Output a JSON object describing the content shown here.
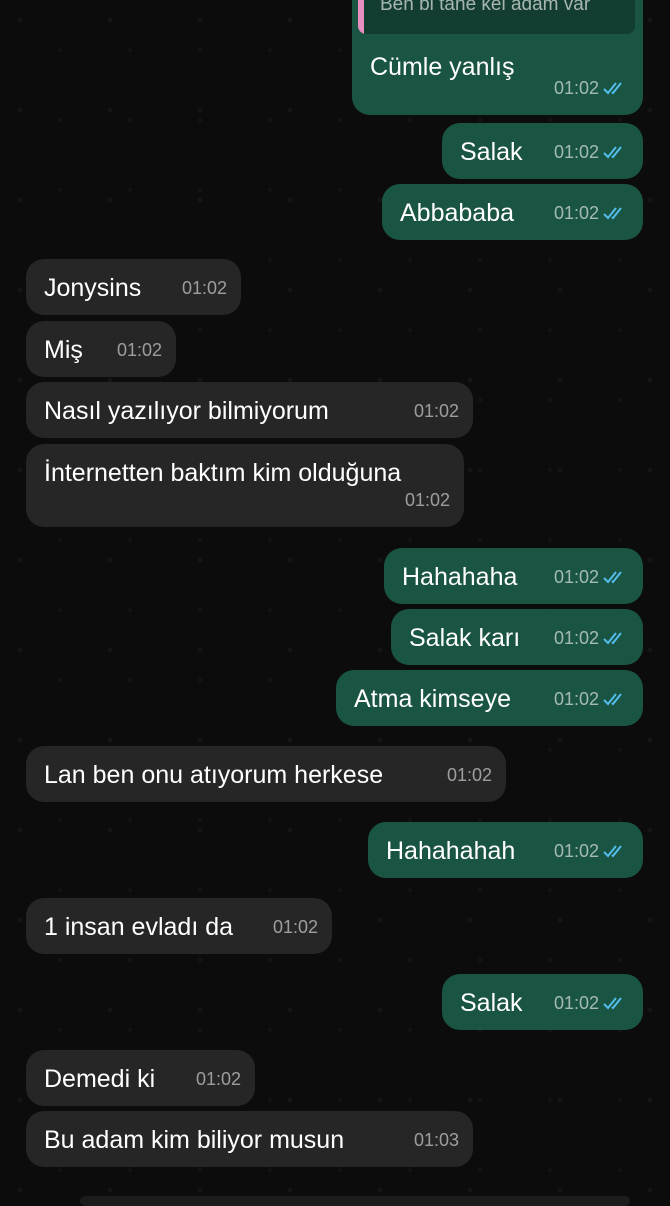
{
  "theme": {
    "incoming_bubble": "#262626",
    "outgoing_bubble": "#1a5443",
    "read_tick_color": "#53bdeb",
    "reply_bar_color": "#e88fc2"
  },
  "messages": [
    {
      "dir": "out",
      "text": "Cümle yanlış",
      "time": "01:02",
      "read": true,
      "quote": "Ben bi tane kel adam var"
    },
    {
      "dir": "out",
      "text": "Salak",
      "time": "01:02",
      "read": true
    },
    {
      "dir": "out",
      "text": "Abbababa",
      "time": "01:02",
      "read": true
    },
    {
      "dir": "in",
      "text": "Jonysins",
      "time": "01:02"
    },
    {
      "dir": "in",
      "text": "Miş",
      "time": "01:02"
    },
    {
      "dir": "in",
      "text": "Nasıl yazılıyor bilmiyorum",
      "time": "01:02"
    },
    {
      "dir": "in",
      "text": "İnternetten baktım kim olduğuna",
      "time": "01:02"
    },
    {
      "dir": "out",
      "text": "Hahahaha",
      "time": "01:02",
      "read": true
    },
    {
      "dir": "out",
      "text": "Salak karı",
      "time": "01:02",
      "read": true
    },
    {
      "dir": "out",
      "text": "Atma kimseye",
      "time": "01:02",
      "read": true
    },
    {
      "dir": "in",
      "text": "Lan ben onu atıyorum herkese",
      "time": "01:02"
    },
    {
      "dir": "out",
      "text": "Hahahahah",
      "time": "01:02",
      "read": true
    },
    {
      "dir": "in",
      "text": "1 insan evladı da",
      "time": "01:02"
    },
    {
      "dir": "out",
      "text": "Salak",
      "time": "01:02",
      "read": true
    },
    {
      "dir": "in",
      "text": "Demedi ki",
      "time": "01:02"
    },
    {
      "dir": "in",
      "text": "Bu adam kim biliyor musun",
      "time": "01:03"
    }
  ]
}
